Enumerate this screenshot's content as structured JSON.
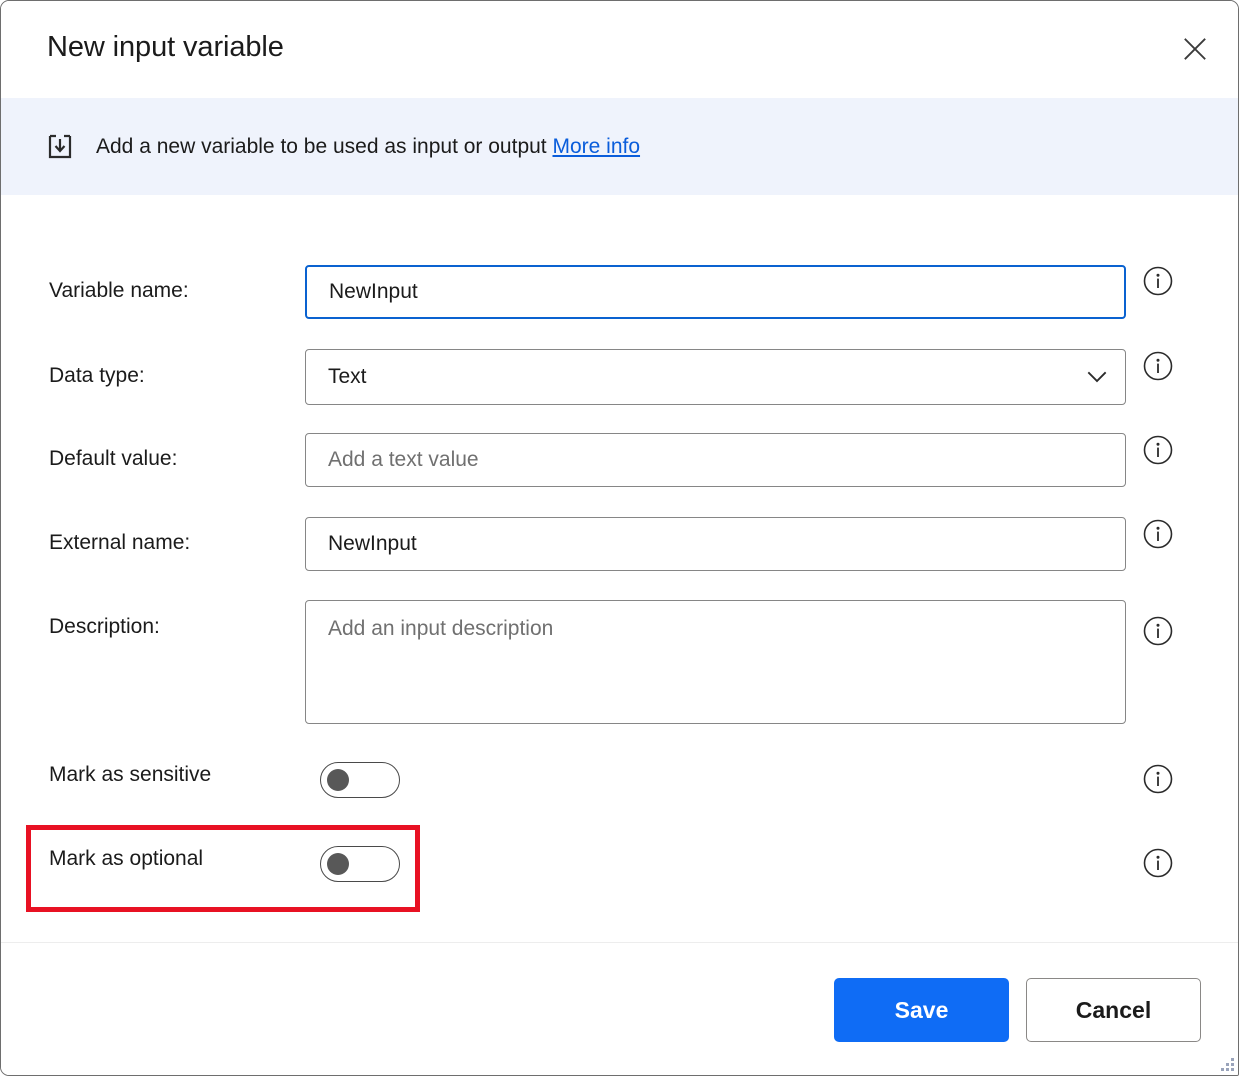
{
  "dialog": {
    "title": "New input variable",
    "close_label": "Close",
    "close_icon": "close-icon"
  },
  "banner": {
    "icon": "input-variable-icon",
    "text": "Add a new variable to be used as input or output",
    "link_label": "More info",
    "background": "#eff3fc",
    "link_color": "#0a5ddb"
  },
  "fields": {
    "variable_name": {
      "label": "Variable name:",
      "value": "NewInput",
      "placeholder": "",
      "focused": true,
      "info": "i"
    },
    "data_type": {
      "label": "Data type:",
      "value": "Text",
      "info": "i"
    },
    "default_value": {
      "label": "Default value:",
      "value": "",
      "placeholder": "Add a text value",
      "info": "i"
    },
    "external_name": {
      "label": "External name:",
      "value": "NewInput",
      "placeholder": "",
      "info": "i"
    },
    "description": {
      "label": "Description:",
      "value": "",
      "placeholder": "Add an input description",
      "info": "i"
    }
  },
  "toggles": [
    {
      "name": "mark-as-sensitive",
      "label": "Mark as sensitive",
      "state": "off",
      "info": "i"
    },
    {
      "name": "mark-as-optional",
      "label": "Mark as optional",
      "state": "off",
      "info": "i",
      "highlighted": true
    }
  ],
  "highlight": {
    "color": "#e81123"
  },
  "footer": {
    "save_label": "Save",
    "cancel_label": "Cancel",
    "save_color": "#0f6cf5"
  }
}
